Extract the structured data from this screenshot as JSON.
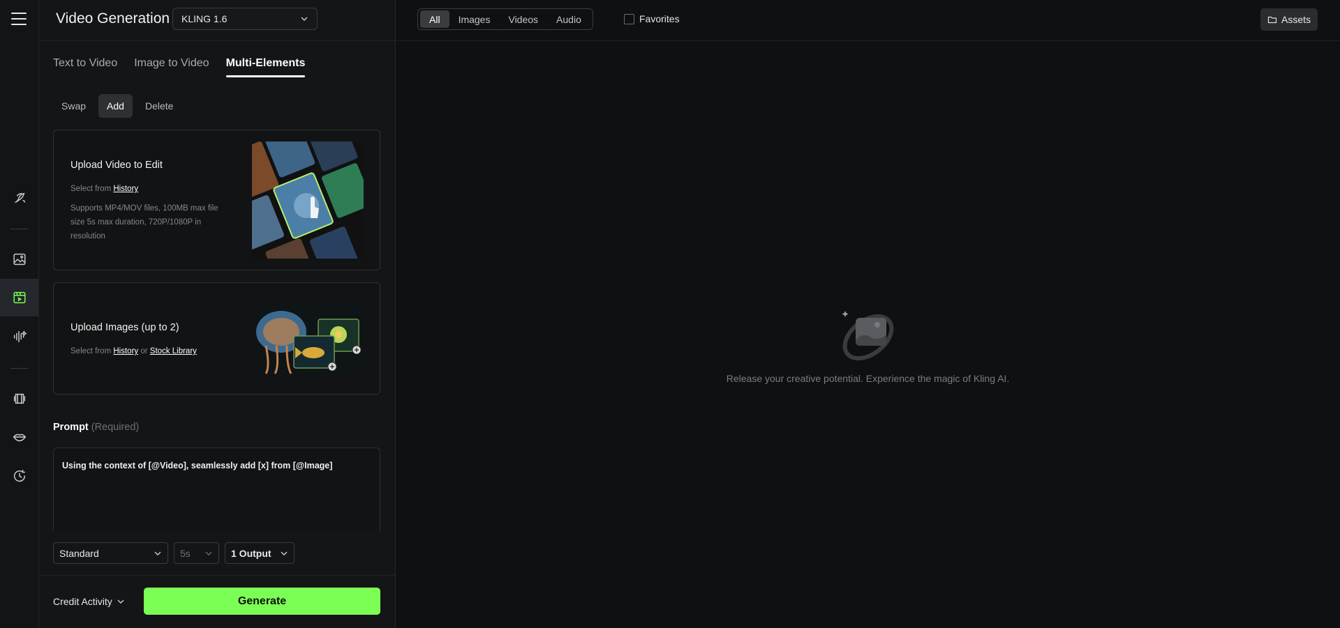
{
  "header": {
    "title": "Video Generation",
    "model": "KLING 1.6"
  },
  "rail": {
    "items": [
      "menu-icon",
      "magic-icon",
      "image-icon",
      "video-icon",
      "audio-icon",
      "avatar-icon",
      "lips-icon",
      "history-icon"
    ],
    "active": "video-icon"
  },
  "modes": [
    {
      "label": "Text to Video",
      "active": false
    },
    {
      "label": "Image to Video",
      "active": false
    },
    {
      "label": "Multi-Elements",
      "active": true
    }
  ],
  "subtabs": [
    {
      "label": "Swap",
      "active": false
    },
    {
      "label": "Add",
      "active": true
    },
    {
      "label": "Delete",
      "active": false
    }
  ],
  "upload_video": {
    "title": "Upload Video to Edit",
    "select_prefix": "Select from",
    "history_link": "History",
    "note": "Supports MP4/MOV files, 100MB max file size 5s max duration, 720P/1080P in resolution"
  },
  "upload_images": {
    "title": "Upload Images (up to 2)",
    "select_prefix": "Select from",
    "history_link": "History",
    "or": "or",
    "stock_link": "Stock Library"
  },
  "prompt": {
    "label": "Prompt",
    "required": "(Required)",
    "value": "Using the context of [@Video], seamlessly add [x] from [@Image]"
  },
  "options": {
    "quality": "Standard",
    "duration": "5s",
    "outputs": "1 Output"
  },
  "footer": {
    "credit_activity": "Credit Activity",
    "generate": "Generate"
  },
  "main": {
    "filters": [
      {
        "label": "All",
        "active": true
      },
      {
        "label": "Images",
        "active": false
      },
      {
        "label": "Videos",
        "active": false
      },
      {
        "label": "Audio",
        "active": false
      }
    ],
    "favorites": "Favorites",
    "assets": "Assets",
    "empty_message": "Release your creative potential. Experience the magic of Kling AI."
  },
  "colors": {
    "accent": "#7cff54",
    "active_rail": "#24272b",
    "background": "#0f1011"
  }
}
